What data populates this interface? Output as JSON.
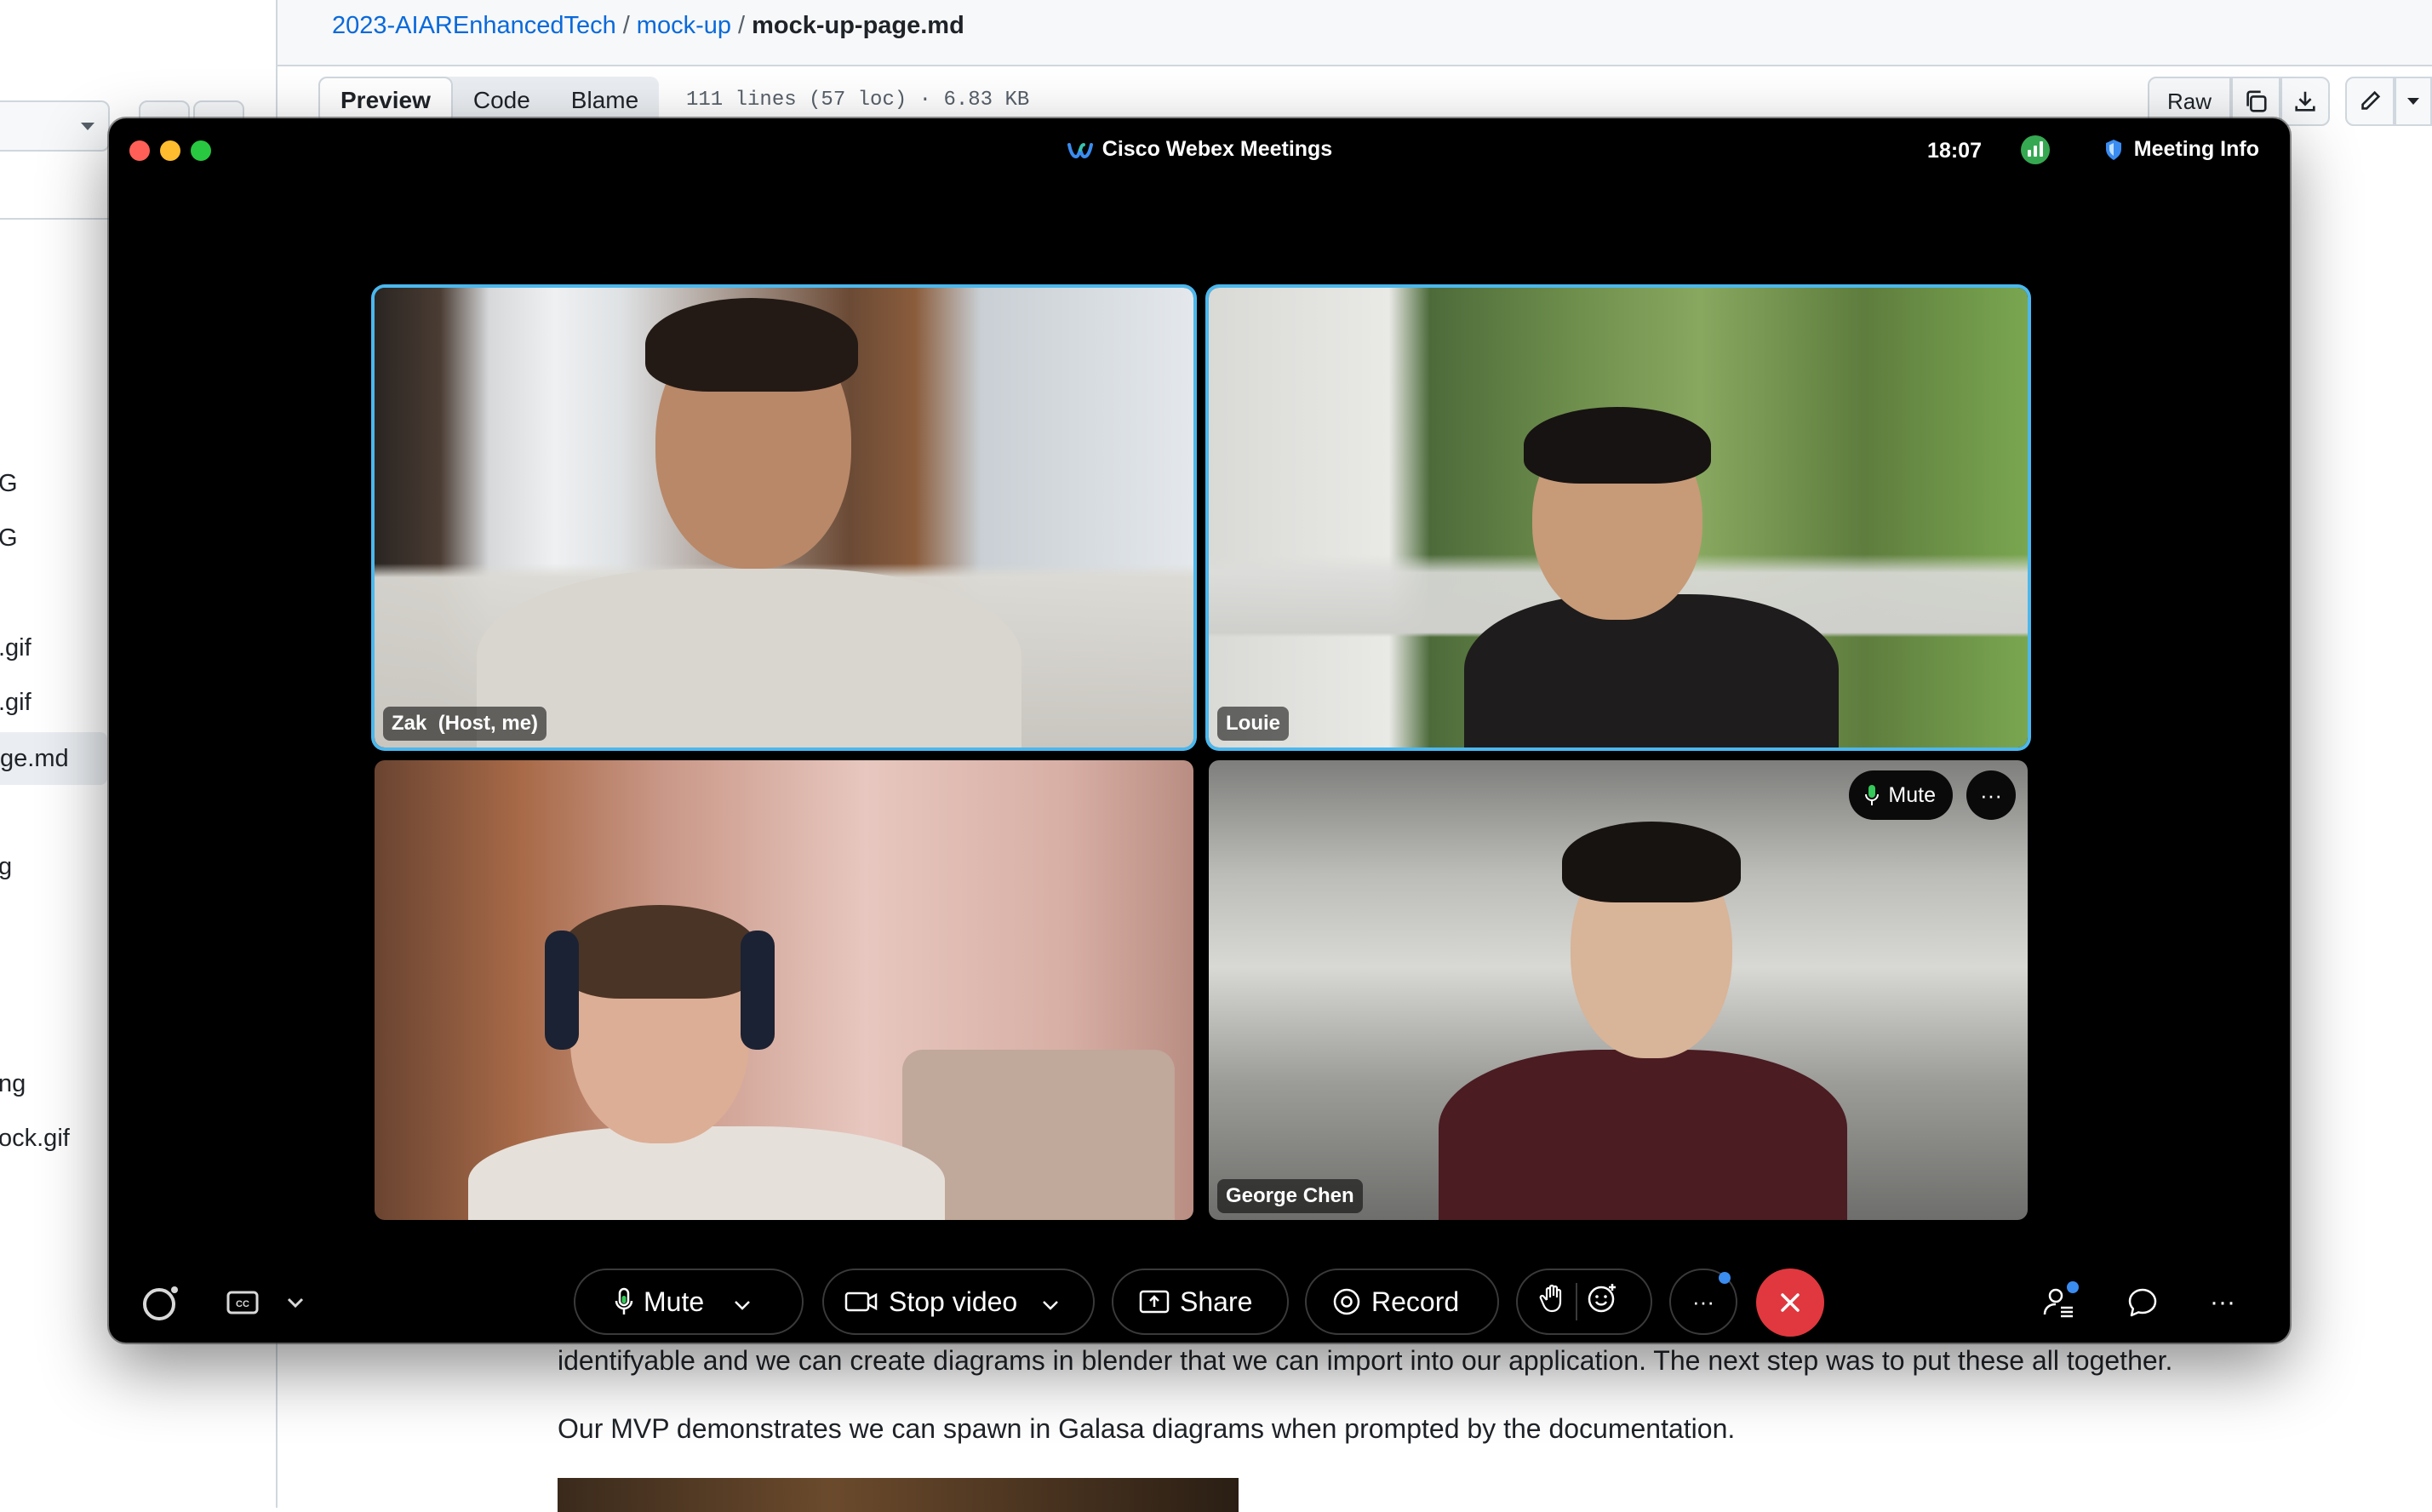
{
  "github": {
    "breadcrumb": {
      "repo": "2023-AIAREnhancedTech",
      "sep1": "/",
      "folder": "mock-up",
      "sep2": "/",
      "file": "mock-up-page.md"
    },
    "tabs": [
      "Preview",
      "Code",
      "Blame"
    ],
    "file_meta": "111 lines (57 loc) · 6.83 KB",
    "raw_label": "Raw",
    "sidebar_files": [
      "G",
      "G",
      ".gif",
      ".gif",
      "ge.md",
      "g",
      "ng",
      "ock.gif"
    ],
    "markdown": {
      "p1": "identifyable and we can create diagrams in blender that we can import into our application. The next step was to put these all together.",
      "p2": "Our MVP demonstrates we can spawn in Galasa diagrams when prompted by the documentation."
    }
  },
  "webex": {
    "title": "Cisco Webex Meetings",
    "time": "18:07",
    "meeting_info": "Meeting Info",
    "participants": [
      {
        "name": "Zak  (Host, me)"
      },
      {
        "name": "Louie"
      },
      {
        "name": ""
      },
      {
        "name": "George Chen"
      }
    ],
    "tile_mute_label": "Mute",
    "tile_more_label": "···",
    "controls": {
      "mute": "Mute",
      "stop_video": "Stop video",
      "share": "Share",
      "record": "Record",
      "more": "···",
      "menu": "···"
    },
    "colors": {
      "accent_blue": "#4bb8ee",
      "end_red": "#e0383e",
      "signal_green": "#36a852"
    }
  }
}
